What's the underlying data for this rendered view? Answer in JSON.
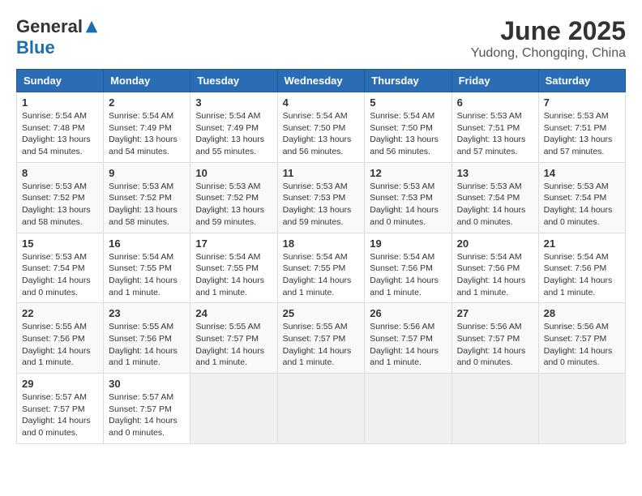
{
  "header": {
    "logo_general": "General",
    "logo_blue": "Blue",
    "month_year": "June 2025",
    "location": "Yudong, Chongqing, China"
  },
  "days_of_week": [
    "Sunday",
    "Monday",
    "Tuesday",
    "Wednesday",
    "Thursday",
    "Friday",
    "Saturday"
  ],
  "weeks": [
    [
      {
        "day": "1",
        "sunrise": "5:54 AM",
        "sunset": "7:48 PM",
        "daylight": "13 hours and 54 minutes."
      },
      {
        "day": "2",
        "sunrise": "5:54 AM",
        "sunset": "7:49 PM",
        "daylight": "13 hours and 54 minutes."
      },
      {
        "day": "3",
        "sunrise": "5:54 AM",
        "sunset": "7:49 PM",
        "daylight": "13 hours and 55 minutes."
      },
      {
        "day": "4",
        "sunrise": "5:54 AM",
        "sunset": "7:50 PM",
        "daylight": "13 hours and 56 minutes."
      },
      {
        "day": "5",
        "sunrise": "5:54 AM",
        "sunset": "7:50 PM",
        "daylight": "13 hours and 56 minutes."
      },
      {
        "day": "6",
        "sunrise": "5:53 AM",
        "sunset": "7:51 PM",
        "daylight": "13 hours and 57 minutes."
      },
      {
        "day": "7",
        "sunrise": "5:53 AM",
        "sunset": "7:51 PM",
        "daylight": "13 hours and 57 minutes."
      }
    ],
    [
      {
        "day": "8",
        "sunrise": "5:53 AM",
        "sunset": "7:52 PM",
        "daylight": "13 hours and 58 minutes."
      },
      {
        "day": "9",
        "sunrise": "5:53 AM",
        "sunset": "7:52 PM",
        "daylight": "13 hours and 58 minutes."
      },
      {
        "day": "10",
        "sunrise": "5:53 AM",
        "sunset": "7:52 PM",
        "daylight": "13 hours and 59 minutes."
      },
      {
        "day": "11",
        "sunrise": "5:53 AM",
        "sunset": "7:53 PM",
        "daylight": "13 hours and 59 minutes."
      },
      {
        "day": "12",
        "sunrise": "5:53 AM",
        "sunset": "7:53 PM",
        "daylight": "14 hours and 0 minutes."
      },
      {
        "day": "13",
        "sunrise": "5:53 AM",
        "sunset": "7:54 PM",
        "daylight": "14 hours and 0 minutes."
      },
      {
        "day": "14",
        "sunrise": "5:53 AM",
        "sunset": "7:54 PM",
        "daylight": "14 hours and 0 minutes."
      }
    ],
    [
      {
        "day": "15",
        "sunrise": "5:53 AM",
        "sunset": "7:54 PM",
        "daylight": "14 hours and 0 minutes."
      },
      {
        "day": "16",
        "sunrise": "5:54 AM",
        "sunset": "7:55 PM",
        "daylight": "14 hours and 1 minute."
      },
      {
        "day": "17",
        "sunrise": "5:54 AM",
        "sunset": "7:55 PM",
        "daylight": "14 hours and 1 minute."
      },
      {
        "day": "18",
        "sunrise": "5:54 AM",
        "sunset": "7:55 PM",
        "daylight": "14 hours and 1 minute."
      },
      {
        "day": "19",
        "sunrise": "5:54 AM",
        "sunset": "7:56 PM",
        "daylight": "14 hours and 1 minute."
      },
      {
        "day": "20",
        "sunrise": "5:54 AM",
        "sunset": "7:56 PM",
        "daylight": "14 hours and 1 minute."
      },
      {
        "day": "21",
        "sunrise": "5:54 AM",
        "sunset": "7:56 PM",
        "daylight": "14 hours and 1 minute."
      }
    ],
    [
      {
        "day": "22",
        "sunrise": "5:55 AM",
        "sunset": "7:56 PM",
        "daylight": "14 hours and 1 minute."
      },
      {
        "day": "23",
        "sunrise": "5:55 AM",
        "sunset": "7:56 PM",
        "daylight": "14 hours and 1 minute."
      },
      {
        "day": "24",
        "sunrise": "5:55 AM",
        "sunset": "7:57 PM",
        "daylight": "14 hours and 1 minute."
      },
      {
        "day": "25",
        "sunrise": "5:55 AM",
        "sunset": "7:57 PM",
        "daylight": "14 hours and 1 minute."
      },
      {
        "day": "26",
        "sunrise": "5:56 AM",
        "sunset": "7:57 PM",
        "daylight": "14 hours and 1 minute."
      },
      {
        "day": "27",
        "sunrise": "5:56 AM",
        "sunset": "7:57 PM",
        "daylight": "14 hours and 0 minutes."
      },
      {
        "day": "28",
        "sunrise": "5:56 AM",
        "sunset": "7:57 PM",
        "daylight": "14 hours and 0 minutes."
      }
    ],
    [
      {
        "day": "29",
        "sunrise": "5:57 AM",
        "sunset": "7:57 PM",
        "daylight": "14 hours and 0 minutes."
      },
      {
        "day": "30",
        "sunrise": "5:57 AM",
        "sunset": "7:57 PM",
        "daylight": "14 hours and 0 minutes."
      },
      null,
      null,
      null,
      null,
      null
    ]
  ]
}
